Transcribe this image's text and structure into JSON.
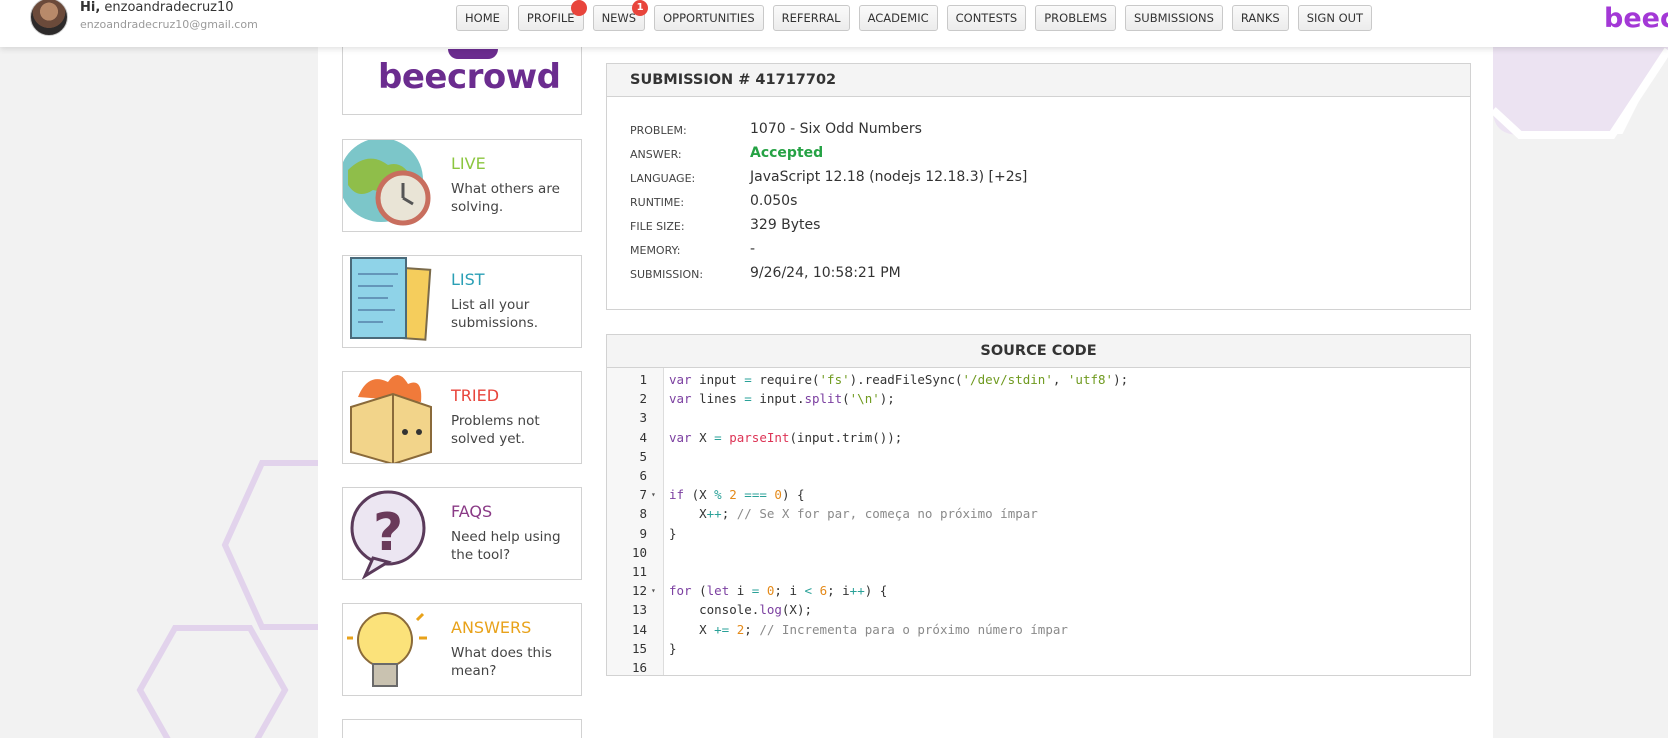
{
  "header": {
    "greeting_prefix": "Hi,",
    "username": "enzoandradecruz10",
    "email": "enzoandradecruz10@gmail.com",
    "brand": "beec",
    "nav": [
      {
        "label": "HOME",
        "badge": ""
      },
      {
        "label": "PROFILE",
        "badge": " "
      },
      {
        "label": "NEWS",
        "badge": "1"
      },
      {
        "label": "OPPORTUNITIES",
        "badge": ""
      },
      {
        "label": "REFERRAL",
        "badge": ""
      },
      {
        "label": "ACADEMIC",
        "badge": ""
      },
      {
        "label": "CONTESTS",
        "badge": ""
      },
      {
        "label": "PROBLEMS",
        "badge": ""
      },
      {
        "label": "SUBMISSIONS",
        "badge": ""
      },
      {
        "label": "RANKS",
        "badge": ""
      },
      {
        "label": "SIGN OUT",
        "badge": ""
      }
    ]
  },
  "sidebar": {
    "logo_text": "beecrowd",
    "cards": [
      {
        "title": "LIVE",
        "desc": "What others are solving.",
        "color": "#8cc63f",
        "icon": "globe-clock-icon"
      },
      {
        "title": "LIST",
        "desc": "List all your submissions.",
        "color": "#2a9fb5",
        "icon": "papers-icon"
      },
      {
        "title": "TRIED",
        "desc": "Problems not solved yet.",
        "color": "#e8453c",
        "icon": "burning-box-icon"
      },
      {
        "title": "FAQS",
        "desc": "Need help using the tool?",
        "color": "#8a3a86",
        "icon": "question-bubble-icon"
      },
      {
        "title": "ANSWERS",
        "desc": "What does this mean?",
        "color": "#e8a21a",
        "icon": "lightbulb-icon"
      }
    ]
  },
  "submission": {
    "header": "SUBMISSION # 41717702",
    "rows": [
      {
        "label": "PROBLEM:",
        "value": "1070 - Six Odd Numbers"
      },
      {
        "label": "ANSWER:",
        "value": "Accepted"
      },
      {
        "label": "LANGUAGE:",
        "value": "JavaScript 12.18 (nodejs 12.18.3) [+2s]"
      },
      {
        "label": "RUNTIME:",
        "value": "0.050s"
      },
      {
        "label": "FILE SIZE:",
        "value": "329 Bytes"
      },
      {
        "label": "MEMORY:",
        "value": "-"
      },
      {
        "label": "SUBMISSION:",
        "value": "9/26/24, 10:58:21 PM"
      }
    ]
  },
  "source": {
    "header": "SOURCE CODE",
    "lines": [
      {
        "n": "1",
        "fold": "",
        "text": "var input = require('fs').readFileSync('/dev/stdin', 'utf8');"
      },
      {
        "n": "2",
        "fold": "",
        "text": "var lines = input.split('\\n');"
      },
      {
        "n": "3",
        "fold": "",
        "text": ""
      },
      {
        "n": "4",
        "fold": "",
        "text": "var X = parseInt(input.trim());"
      },
      {
        "n": "5",
        "fold": "",
        "text": ""
      },
      {
        "n": "6",
        "fold": "",
        "text": ""
      },
      {
        "n": "7",
        "fold": "▾",
        "text": "if (X % 2 === 0) {"
      },
      {
        "n": "8",
        "fold": "",
        "text": "    X++; // Se X for par, começa no próximo ímpar"
      },
      {
        "n": "9",
        "fold": "",
        "text": "}"
      },
      {
        "n": "10",
        "fold": "",
        "text": ""
      },
      {
        "n": "11",
        "fold": "",
        "text": ""
      },
      {
        "n": "12",
        "fold": "▾",
        "text": "for (let i = 0; i < 6; i++) {"
      },
      {
        "n": "13",
        "fold": "",
        "text": "    console.log(X);"
      },
      {
        "n": "14",
        "fold": "",
        "text": "    X += 2; // Incrementa para o próximo número ímpar"
      },
      {
        "n": "15",
        "fold": "",
        "text": "}"
      },
      {
        "n": "16",
        "fold": "",
        "text": ""
      }
    ]
  }
}
